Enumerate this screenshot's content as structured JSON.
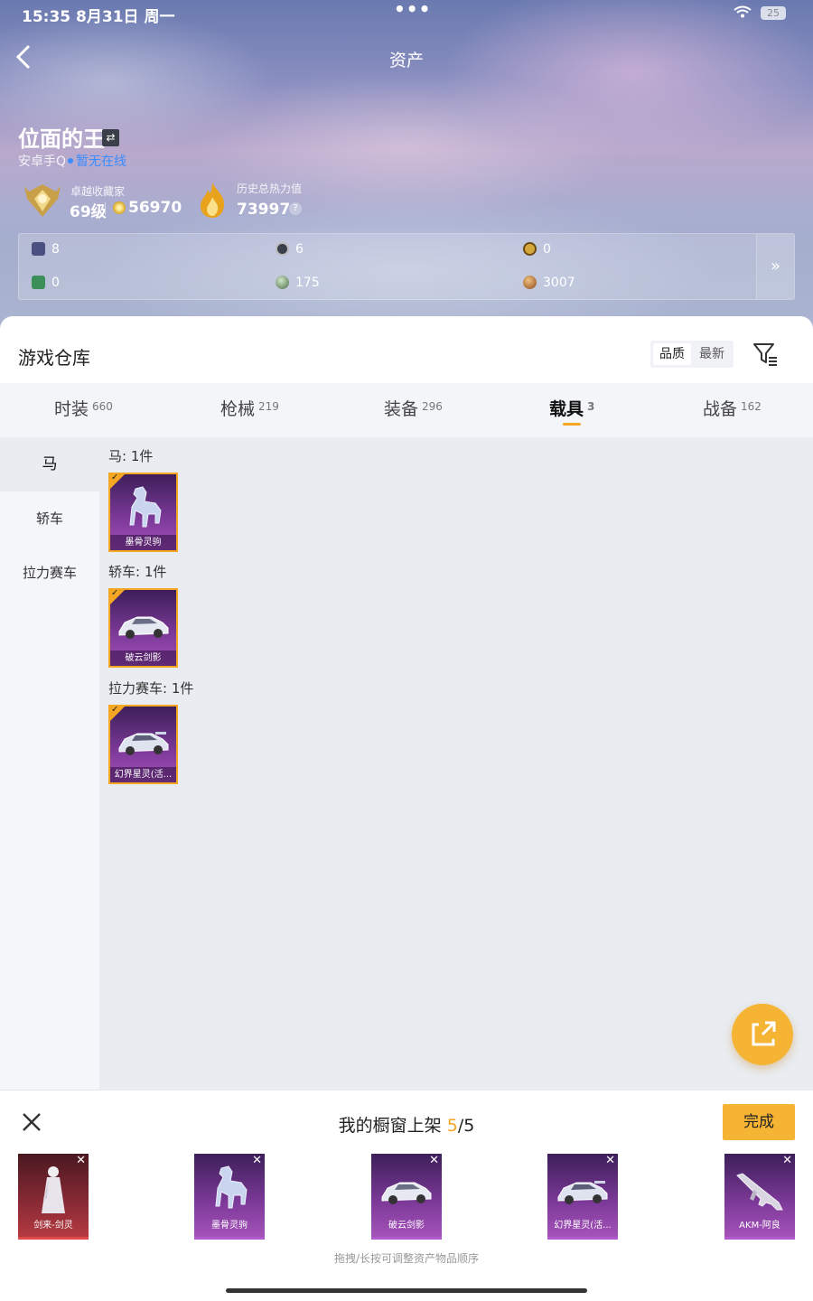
{
  "status_bar": {
    "time": "15:35",
    "date": "8月31日 周一",
    "battery": "25"
  },
  "nav": {
    "title": "资产"
  },
  "profile": {
    "name": "位面的王",
    "platform": "安卓手Q",
    "online_status": "暂无在线",
    "collector_label": "卓越收藏家",
    "level": "69级",
    "coins": "56970",
    "heat_label": "历史总热力值",
    "heat_value": "73997",
    "help": "?"
  },
  "stats": [
    {
      "icon": "book-icon",
      "value": "8"
    },
    {
      "icon": "badge-s-icon",
      "value": "6"
    },
    {
      "icon": "gold-a-icon",
      "value": "0"
    },
    {
      "icon": "green-gem-icon",
      "value": "0"
    },
    {
      "icon": "orb-icon",
      "value": "175"
    },
    {
      "icon": "bronze-coin-icon",
      "value": "3007"
    }
  ],
  "warehouse": {
    "title": "游戏仓库",
    "sort": [
      "品质",
      "最新"
    ],
    "tabs": [
      {
        "label": "时装",
        "count": "660"
      },
      {
        "label": "枪械",
        "count": "219"
      },
      {
        "label": "装备",
        "count": "296"
      },
      {
        "label": "载具",
        "count": "3"
      },
      {
        "label": "战备",
        "count": "162"
      }
    ],
    "active_tab": "载具",
    "side_categories": [
      "马",
      "轿车",
      "拉力赛车"
    ],
    "groups": [
      {
        "label": "马: 1件",
        "item": "墨骨灵驹",
        "art": "horse"
      },
      {
        "label": "轿车: 1件",
        "item": "破云剑影",
        "art": "car"
      },
      {
        "label": "拉力赛车: 1件",
        "item": "幻界星灵(活...",
        "art": "car"
      }
    ]
  },
  "showcase": {
    "title": "我的橱窗上架",
    "count": "5",
    "total": "/5",
    "done_label": "完成",
    "items": [
      {
        "name": "剑来-剑灵",
        "quality": "red"
      },
      {
        "name": "墨骨灵驹",
        "quality": "purple"
      },
      {
        "name": "破云剑影",
        "quality": "purple"
      },
      {
        "name": "幻界星灵(活...",
        "quality": "purple"
      },
      {
        "name": "AKM-阿良",
        "quality": "purple"
      }
    ],
    "hint": "拖拽/长按可调整资产物品顺序"
  },
  "colors": {
    "accent": "#f5a623",
    "fab": "#f5b434",
    "link": "#3a8cff",
    "purple_quality": "#7e3a9a",
    "red_quality": "#b43a40"
  }
}
